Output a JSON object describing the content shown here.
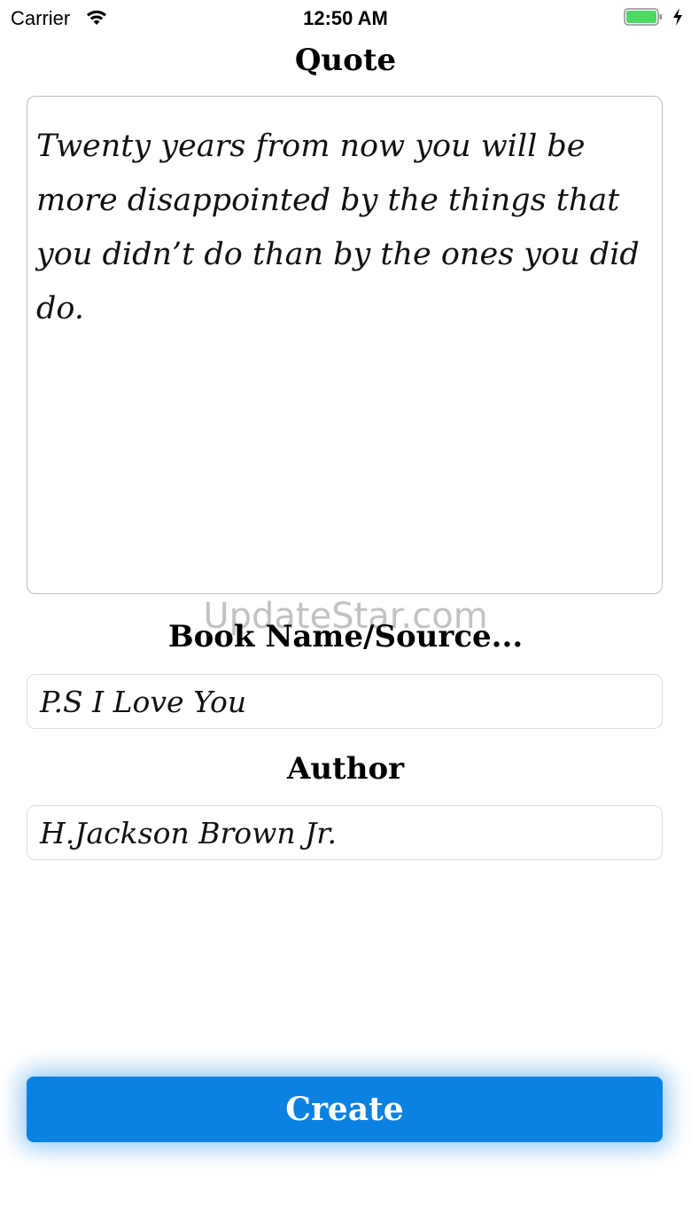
{
  "status_bar": {
    "carrier": "Carrier",
    "time": "12:50 AM",
    "wifi_icon": "wifi-icon",
    "battery_icon": "battery-icon",
    "charging_icon": "bolt-icon",
    "battery_color": "#4cd964"
  },
  "quote": {
    "label": "Quote",
    "text": "Twenty years from now you will be more disappointed by the things that you didn’t do than by the ones you did do."
  },
  "source": {
    "label": "Book Name/Source...",
    "value": "P.S I Love You"
  },
  "author": {
    "label": "Author",
    "value": "H.Jackson Brown Jr."
  },
  "watermark": "UpdateStar.com",
  "create_button": {
    "label": "Create",
    "color": "#0b82e2"
  }
}
